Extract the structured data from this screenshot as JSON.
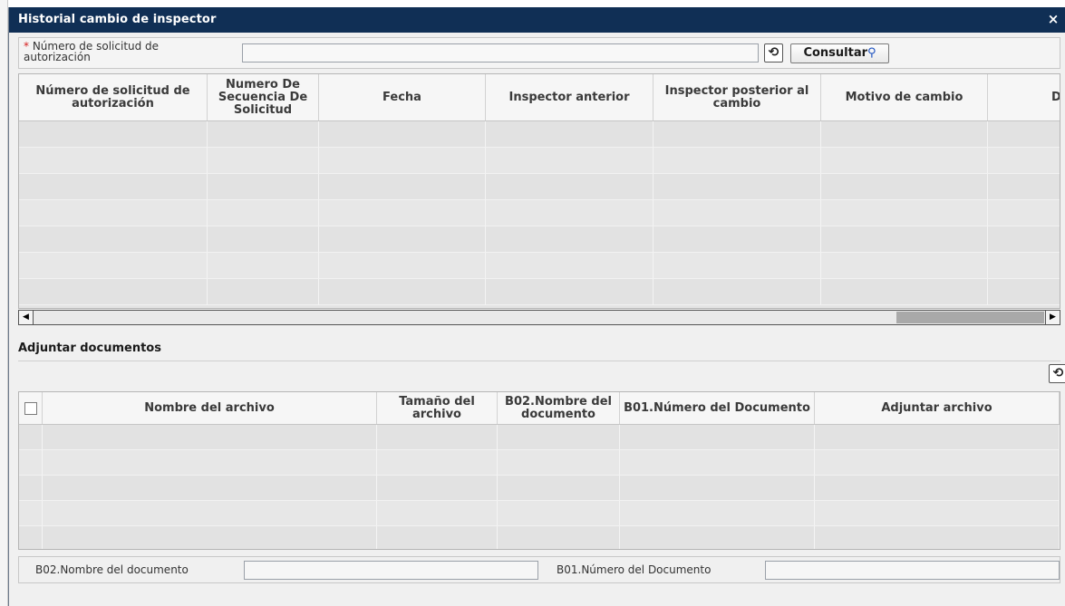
{
  "dialog": {
    "title": "Historial cambio de inspector",
    "close_glyph": "×"
  },
  "search": {
    "required_mark": "*",
    "label": "Número de solicitud de autorización",
    "input_value": "",
    "refresh_icon": "refresh-icon",
    "consult_label": "Consultar",
    "consult_icon": "search-icon"
  },
  "grid1": {
    "columns": [
      "Número de solicitud de autorización",
      "Numero De Secuencia De Solicitud",
      "Fecha",
      "Inspector anterior",
      "Inspector posterior al cambio",
      "Motivo de cambio",
      "De"
    ]
  },
  "scrollbar": {
    "left_arrow": "◀",
    "right_arrow": "▶"
  },
  "attachments": {
    "title": "Adjuntar documentos",
    "refresh_icon": "refresh-icon",
    "columns": [
      "Nombre del archivo",
      "Tamaño del archivo",
      "B02.Nombre del documento",
      "B01.Número del Documento",
      "Adjuntar archivo"
    ]
  },
  "footer": {
    "doc_name_label": "B02.Nombre del documento",
    "doc_name_value": "",
    "doc_number_label": "B01.Número del Documento",
    "doc_number_value": ""
  }
}
